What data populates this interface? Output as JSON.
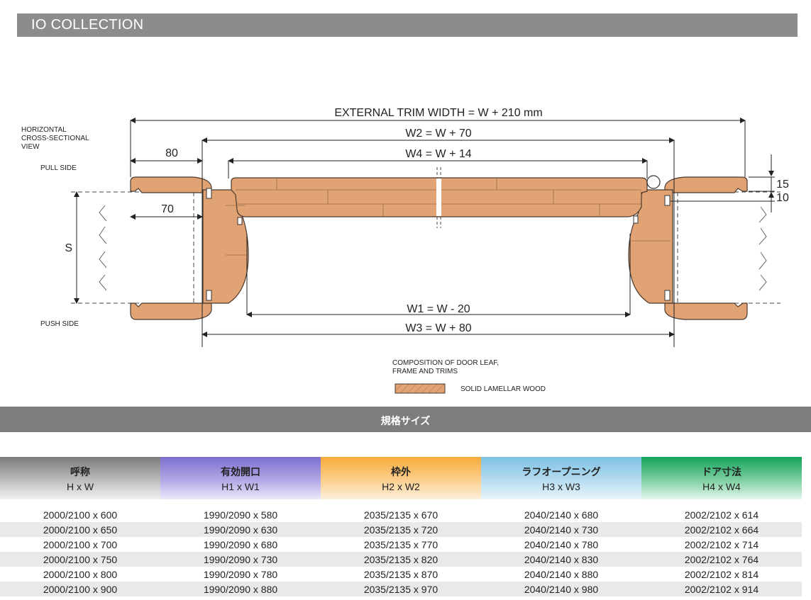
{
  "header": {
    "title": "IO COLLECTION"
  },
  "view_label": "HORIZONTAL\nCROSS-SECTIONAL\nVIEW",
  "pull_side": "PULL SIDE",
  "push_side": "PUSH SIDE",
  "dims": {
    "external": "EXTERNAL TRIM WIDTH = W + 210 mm",
    "w2": "W2 = W + 70",
    "w4": "W4 = W + 14",
    "w1": "W1 = W - 20",
    "w3": "W3 = W + 80",
    "d80": "80",
    "d70": "70",
    "d15": "15",
    "d10": "10",
    "s": "S"
  },
  "legend": {
    "title": "COMPOSITION OF DOOR LEAF,\nFRAME AND TRIMS",
    "item": "SOLID LAMELLAR WOOD"
  },
  "section": {
    "title": "規格サイズ"
  },
  "table": {
    "headers": [
      {
        "jp": "呼称",
        "en": "H x W"
      },
      {
        "jp": "有効開口",
        "en": "H1 x W1"
      },
      {
        "jp": "枠外",
        "en": "H2 x W2"
      },
      {
        "jp": "ラフオープニング",
        "en": "H3 x W3"
      },
      {
        "jp": "ドア寸法",
        "en": "H4 x W4"
      }
    ],
    "rows": [
      [
        "2000/2100 x 600",
        "1990/2090 x 580",
        "2035/2135 x 670",
        "2040/2140 x 680",
        "2002/2102 x 614"
      ],
      [
        "2000/2100 x 650",
        "1990/2090 x 630",
        "2035/2135 x 720",
        "2040/2140 x 730",
        "2002/2102 x 664"
      ],
      [
        "2000/2100 x 700",
        "1990/2090 x 680",
        "2035/2135 x 770",
        "2040/2140 x 780",
        "2002/2102 x 714"
      ],
      [
        "2000/2100 x 750",
        "1990/2090 x 730",
        "2035/2135 x 820",
        "2040/2140 x 830",
        "2002/2102 x 764"
      ],
      [
        "2000/2100 x 800",
        "1990/2090 x 780",
        "2035/2135 x 870",
        "2040/2140 x 880",
        "2002/2102 x 814"
      ],
      [
        "2000/2100 x 900",
        "1990/2090 x 880",
        "2035/2135 x 970",
        "2040/2140 x 980",
        "2002/2102 x 914"
      ]
    ]
  },
  "colors": {
    "wood": "#e1a373",
    "wood_stroke": "#4a3a30",
    "header_bar": "#8c8c8c",
    "section_bar": "#7d7d7d"
  }
}
